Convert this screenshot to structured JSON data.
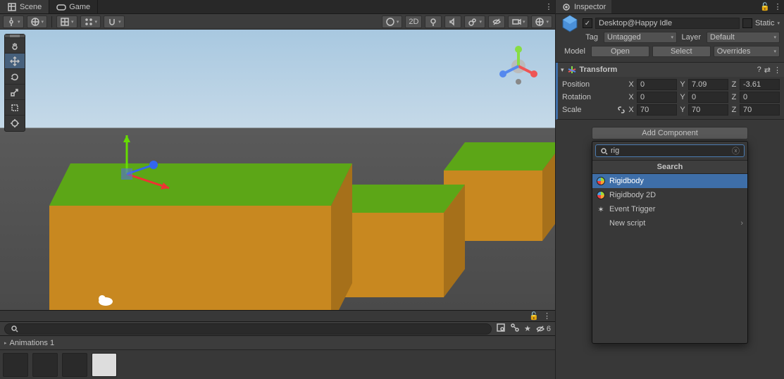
{
  "tabs": {
    "scene": "Scene",
    "game": "Game",
    "inspector": "Inspector"
  },
  "scene_toolbar": {
    "mode_2d": "2D"
  },
  "inspector": {
    "object_name": "Desktop@Happy Idle",
    "static_label": "Static",
    "tag_label": "Tag",
    "tag_value": "Untagged",
    "layer_label": "Layer",
    "layer_value": "Default",
    "model_label": "Model",
    "open_btn": "Open",
    "select_btn": "Select",
    "overrides_btn": "Overrides"
  },
  "transform": {
    "title": "Transform",
    "position_label": "Position",
    "rotation_label": "Rotation",
    "scale_label": "Scale",
    "pos": {
      "x": "0",
      "y": "7.09",
      "z": "-3.61"
    },
    "rot": {
      "x": "0",
      "y": "0",
      "z": "0"
    },
    "scl": {
      "x": "70",
      "y": "70",
      "z": "70"
    }
  },
  "add_component": {
    "button": "Add Component",
    "search_value": "rig",
    "header": "Search",
    "items": {
      "rigidbody": "Rigidbody",
      "rigidbody2d": "Rigidbody 2D",
      "event_trigger": "Event Trigger",
      "new_script": "New script"
    }
  },
  "animations": {
    "title": "Animations 1"
  },
  "eye_count": "6",
  "axis": {
    "x": "X",
    "y": "Y",
    "z": "Z"
  }
}
